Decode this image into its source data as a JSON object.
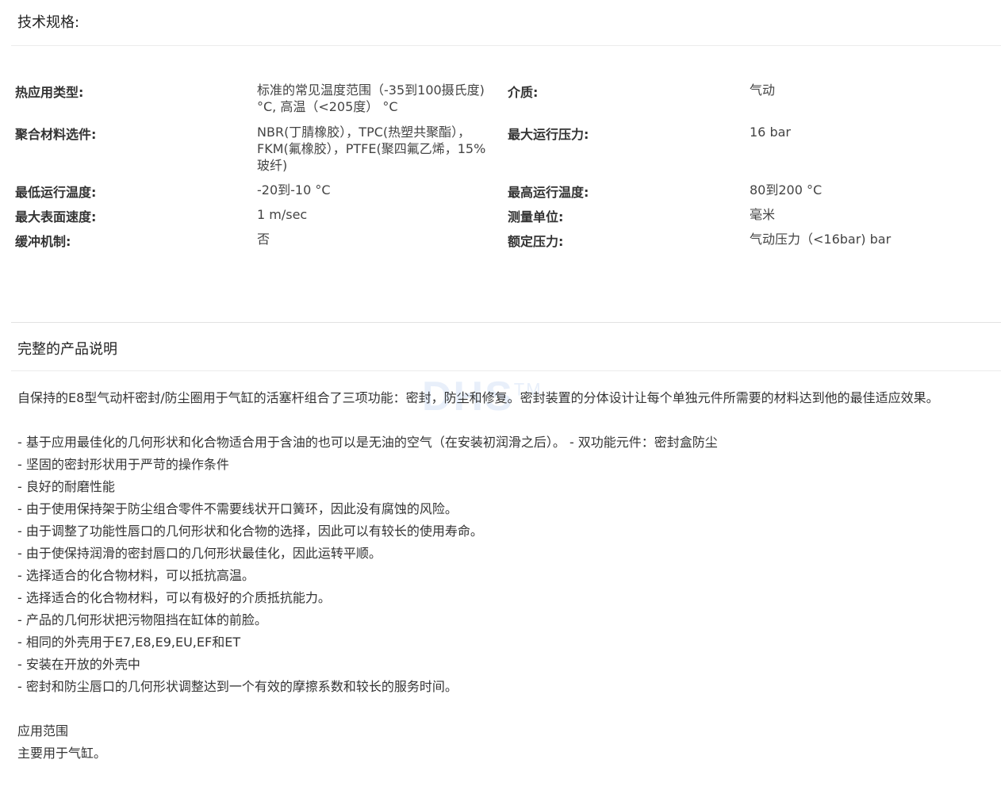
{
  "specs": {
    "title": "技术规格:",
    "rows": [
      {
        "l1": "热应用类型:",
        "v1": "标准的常见温度范围（-35到100摄氏度) °C, 高温（<205度） °C",
        "l2": "介质:",
        "v2": "气动"
      },
      {
        "l1": "聚合材料选件:",
        "v1": "NBR(丁腈橡胶），TPC(热塑共聚酯），FKM(氟橡胶），PTFE(聚四氟乙烯，15%玻纤)",
        "l2": "最大运行压力:",
        "v2": "16 bar"
      },
      {
        "l1": "最低运行温度:",
        "v1": "-20到-10 °C",
        "l2": "最高运行温度:",
        "v2": "80到200 °C"
      },
      {
        "l1": "最大表面速度:",
        "v1": "1 m/sec",
        "l2": "测量单位:",
        "v2": "毫米"
      },
      {
        "l1": "缓冲机制:",
        "v1": "否",
        "l2": "额定压力:",
        "v2": "气动压力（<16bar) bar"
      }
    ]
  },
  "description": {
    "title": "完整的产品说明",
    "intro": "自保持的E8型气动杆密封/防尘圈用于气缸的活塞杆组合了三项功能：密封，防尘和修复。密封装置的分体设计让每个单独元件所需要的材料达到他的最佳适应效果。",
    "bullets": [
      "- 基于应用最佳化的几何形状和化合物适合用于含油的也可以是无油的空气（在安装初润滑之后）。 - 双功能元件：密封盒防尘",
      "- 坚固的密封形状用于严苛的操作条件",
      "- 良好的耐磨性能",
      "- 由于使用保持架于防尘组合零件不需要线状开口簧环，因此没有腐蚀的风险。",
      "- 由于调整了功能性唇口的几何形状和化合物的选择，因此可以有较长的使用寿命。",
      "- 由于使保持润滑的密封唇口的几何形状最佳化，因此运转平顺。",
      "- 选择适合的化合物材料，可以抵抗高温。",
      "- 选择适合的化合物材料，可以有极好的介质抵抗能力。",
      "- 产品的几何形状把污物阻挡在缸体的前脸。",
      "- 相同的外壳用于E7,E8,E9,EU,EF和ET",
      "- 安装在开放的外壳中",
      "- 密封和防尘唇口的几何形状调整达到一个有效的摩擦系数和较长的服务时间。"
    ],
    "application_title": "应用范围",
    "application_text": "主要用于气缸。"
  },
  "watermark": {
    "text": "DHS",
    "mark": "TM"
  }
}
